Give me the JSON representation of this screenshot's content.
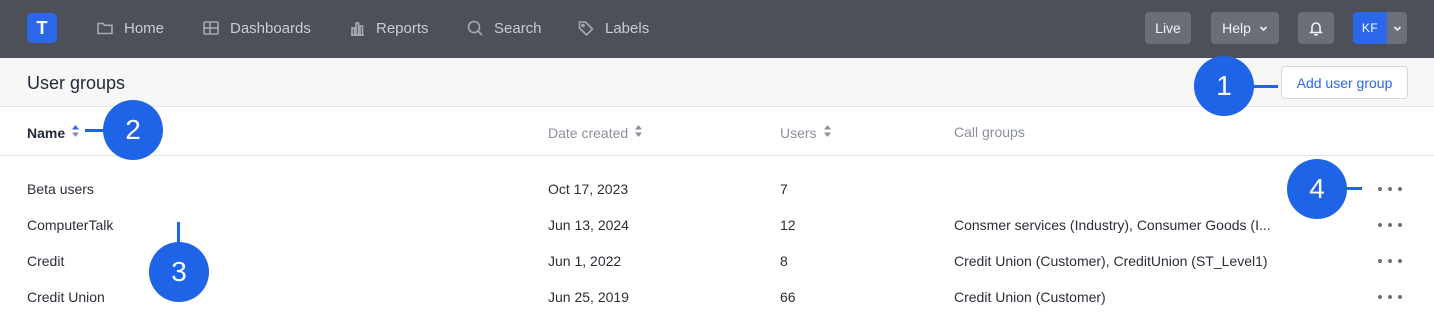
{
  "topbar": {
    "logo_letter": "T",
    "nav": [
      {
        "label": "Home",
        "icon": "folder-icon"
      },
      {
        "label": "Dashboards",
        "icon": "dashboard-icon"
      },
      {
        "label": "Reports",
        "icon": "bar-chart-icon"
      },
      {
        "label": "Search",
        "icon": "search-icon"
      },
      {
        "label": "Labels",
        "icon": "tag-icon"
      }
    ],
    "live_label": "Live",
    "help_label": "Help",
    "avatar_initials": "KF"
  },
  "page": {
    "title": "User groups",
    "add_button_label": "Add user group"
  },
  "table": {
    "columns": [
      "Name",
      "Date created",
      "Users",
      "Call groups"
    ],
    "rows": [
      {
        "name": "Beta users",
        "date": "Oct 17, 2023",
        "users": "7",
        "call_groups": ""
      },
      {
        "name": "ComputerTalk",
        "date": "Jun 13, 2024",
        "users": "12",
        "call_groups": "Consmer services (Industry), Consumer Goods (I..."
      },
      {
        "name": "Credit",
        "date": "Jun 1, 2022",
        "users": "8",
        "call_groups": "Credit Union (Customer), CreditUnion (ST_Level1)"
      },
      {
        "name": "Credit Union",
        "date": "Jun 25, 2019",
        "users": "66",
        "call_groups": "Credit Union (Customer)"
      }
    ]
  },
  "callouts": [
    "1",
    "2",
    "3",
    "4"
  ],
  "colors": {
    "accent": "#2b67ea",
    "topbar": "#4b5059",
    "callout": "#1f63e6"
  }
}
